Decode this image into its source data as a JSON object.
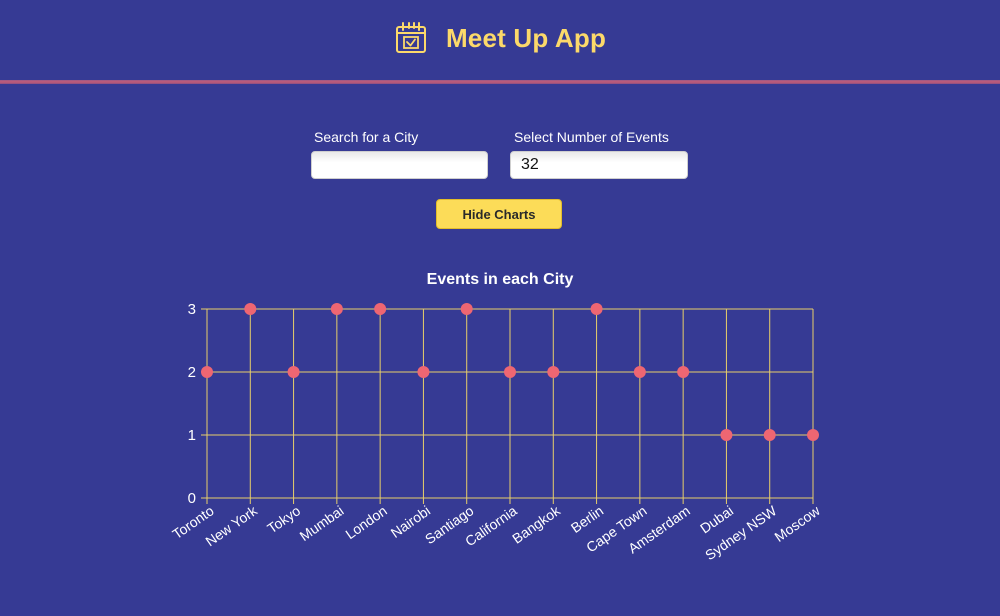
{
  "header": {
    "title": "Meet Up App",
    "icon": "calendar-check-icon",
    "title_color": "#fcd96a"
  },
  "search": {
    "city_label": "Search for a City",
    "city_value": "",
    "events_label": "Select Number of Events",
    "events_value": "32"
  },
  "toggle_button": {
    "label": "Hide Charts"
  },
  "colors": {
    "background": "#363a94",
    "accent": "#fcdc58",
    "point": "#ee6672",
    "grid": "#e8cf6a"
  },
  "chart_data": {
    "type": "scatter",
    "title": "Events in each City",
    "categories": [
      "Toronto",
      "New York",
      "Tokyo",
      "Mumbai",
      "London",
      "Nairobi",
      "Santiago",
      "California",
      "Bangkok",
      "Berlin",
      "Cape Town",
      "Amsterdam",
      "Dubai",
      "Sydney NSW",
      "Moscow"
    ],
    "values": [
      2,
      3,
      2,
      3,
      3,
      2,
      3,
      2,
      2,
      3,
      2,
      2,
      1,
      1,
      1
    ],
    "ylim": [
      0,
      3
    ],
    "yticks": [
      "0",
      "1",
      "2",
      "3"
    ],
    "grid": true
  }
}
